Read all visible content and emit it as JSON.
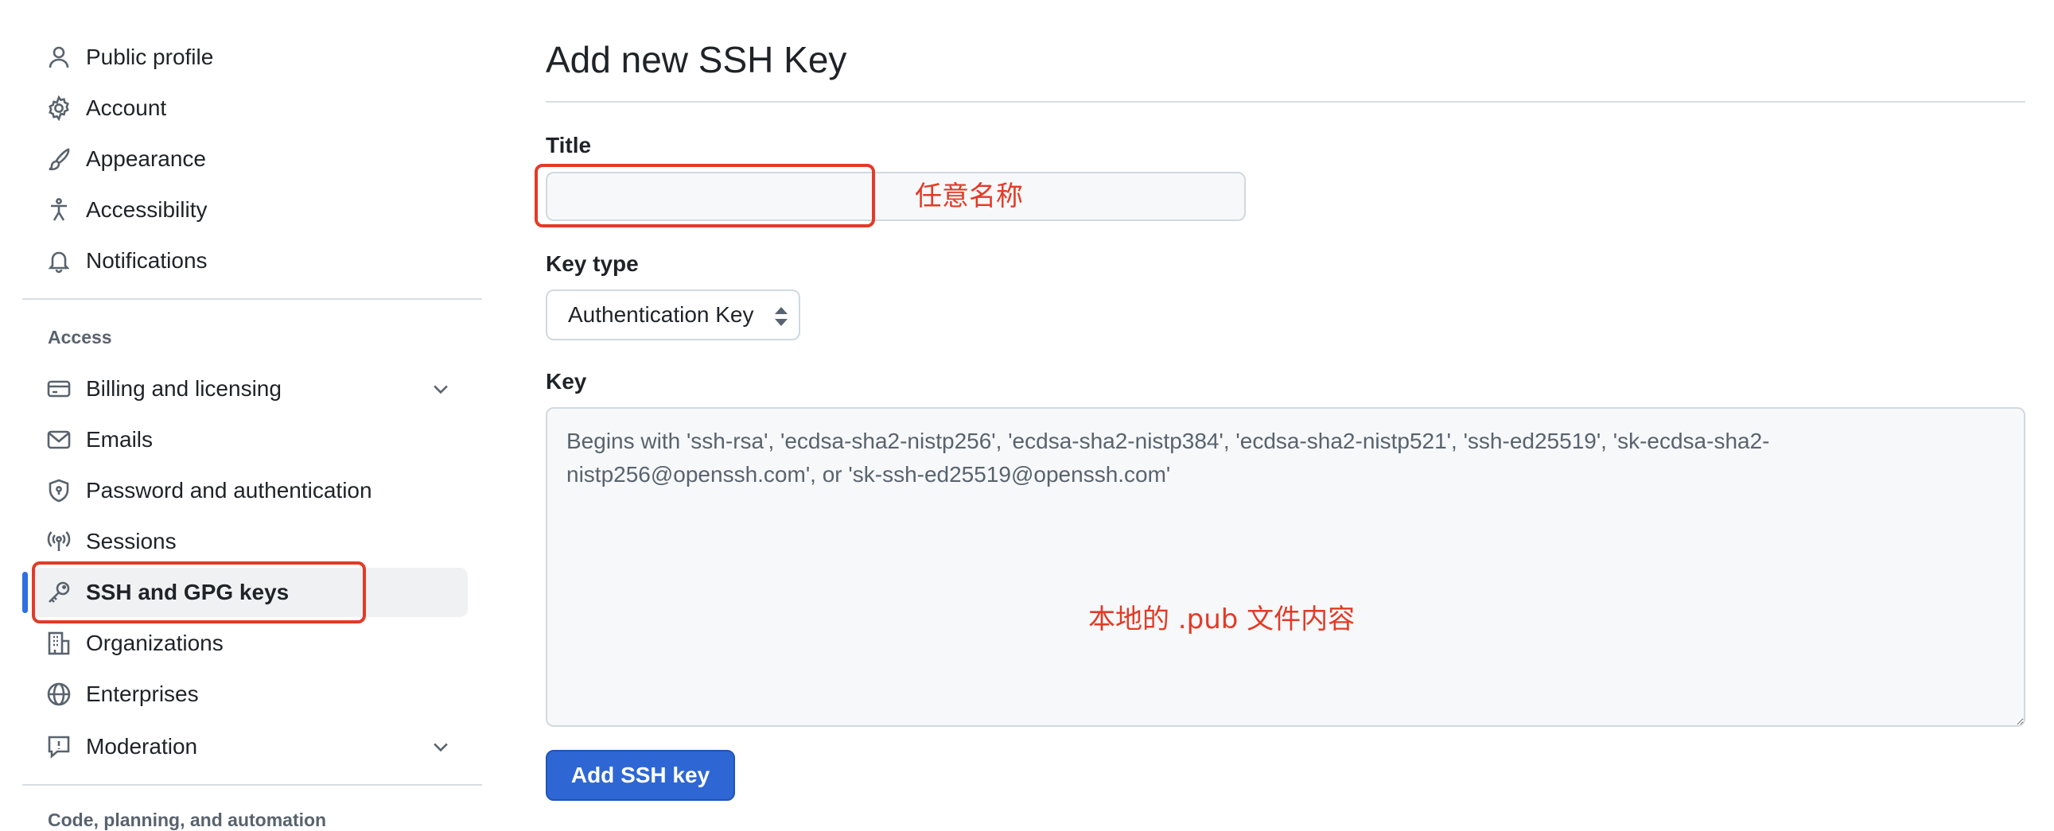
{
  "sidebar": {
    "items": [
      {
        "label": "Public profile",
        "icon": "person-icon"
      },
      {
        "label": "Account",
        "icon": "gear-icon"
      },
      {
        "label": "Appearance",
        "icon": "paintbrush-icon"
      },
      {
        "label": "Accessibility",
        "icon": "accessibility-icon"
      },
      {
        "label": "Notifications",
        "icon": "bell-icon"
      }
    ],
    "access_heading": "Access",
    "access_items": [
      {
        "label": "Billing and licensing",
        "icon": "credit-card-icon",
        "expandable": true
      },
      {
        "label": "Emails",
        "icon": "mail-icon"
      },
      {
        "label": "Password and authentication",
        "icon": "shield-lock-icon"
      },
      {
        "label": "Sessions",
        "icon": "broadcast-icon"
      },
      {
        "label": "SSH and GPG keys",
        "icon": "key-icon",
        "selected": true
      },
      {
        "label": "Organizations",
        "icon": "organization-icon"
      },
      {
        "label": "Enterprises",
        "icon": "globe-icon"
      },
      {
        "label": "Moderation",
        "icon": "report-icon",
        "expandable": true
      }
    ],
    "next_heading": "Code, planning, and automation"
  },
  "form": {
    "page_title": "Add new SSH Key",
    "title_label": "Title",
    "title_value": "",
    "key_type_label": "Key type",
    "key_type_selected": "Authentication Key",
    "key_label": "Key",
    "key_placeholder": "Begins with 'ssh-rsa', 'ecdsa-sha2-nistp256', 'ecdsa-sha2-nistp384', 'ecdsa-sha2-nistp521', 'ssh-ed25519', 'sk-ecdsa-sha2-nistp256@openssh.com', or 'sk-ssh-ed25519@openssh.com'",
    "submit_label": "Add SSH key"
  },
  "annotations": {
    "title_note": "任意名称",
    "key_note": "本地的 .pub 文件内容"
  },
  "colors": {
    "accent": "#2e67d3",
    "annotation": "#e23b26",
    "selected_bg": "#eff1f3"
  }
}
